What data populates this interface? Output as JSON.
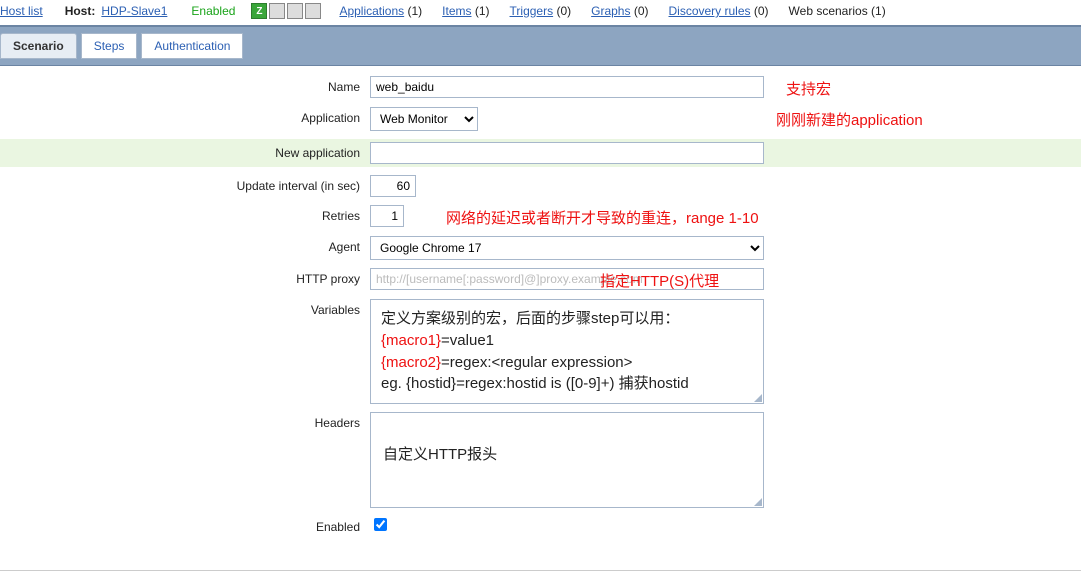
{
  "topbar": {
    "hostlist": "Host list",
    "host_label": "Host:",
    "host_name": "HDP-Slave1",
    "enabled": "Enabled",
    "icons": [
      "Z",
      "",
      "",
      ""
    ],
    "nav": [
      {
        "label": "Applications",
        "count": "(1)",
        "link": true
      },
      {
        "label": "Items",
        "count": "(1)",
        "link": true
      },
      {
        "label": "Triggers",
        "count": "(0)",
        "link": true
      },
      {
        "label": "Graphs",
        "count": "(0)",
        "link": true
      },
      {
        "label": "Discovery rules",
        "count": "(0)",
        "link": true
      },
      {
        "label": "Web scenarios",
        "count": "(1)",
        "link": false
      }
    ]
  },
  "tabs": {
    "scenario": "Scenario",
    "steps": "Steps",
    "auth": "Authentication"
  },
  "form": {
    "name_label": "Name",
    "name_value": "web_baidu",
    "name_ann": "支持宏",
    "application_label": "Application",
    "application_value": "Web Monitor",
    "application_ann": "刚刚新建的application",
    "new_application_label": "New application",
    "new_application_value": "",
    "update_interval_label": "Update interval (in sec)",
    "update_interval_value": "60",
    "retries_label": "Retries",
    "retries_value": "1",
    "retries_ann": "网络的延迟或者断开才导致的重连，range 1-10",
    "agent_label": "Agent",
    "agent_value": "Google Chrome 17",
    "httpproxy_label": "HTTP proxy",
    "httpproxy_placeholder": "http://[username[:password]@]proxy.example.com",
    "httpproxy_ann": "指定HTTP(S)代理",
    "variables_label": "Variables",
    "variables_line1": "定义方案级别的宏，后面的步骤step可以用：",
    "variables_macro1": "{macro1}",
    "variables_macro1_rest": "=value1",
    "variables_macro2": "{macro2}",
    "variables_macro2_rest": "=regex:<regular expression>",
    "variables_line4": "eg. {hostid}=regex:hostid is ([0-9]+) 捕获hostid",
    "headers_label": "Headers",
    "headers_ann": "自定义HTTP报头",
    "enabled_label": "Enabled",
    "enabled_checked": true
  }
}
